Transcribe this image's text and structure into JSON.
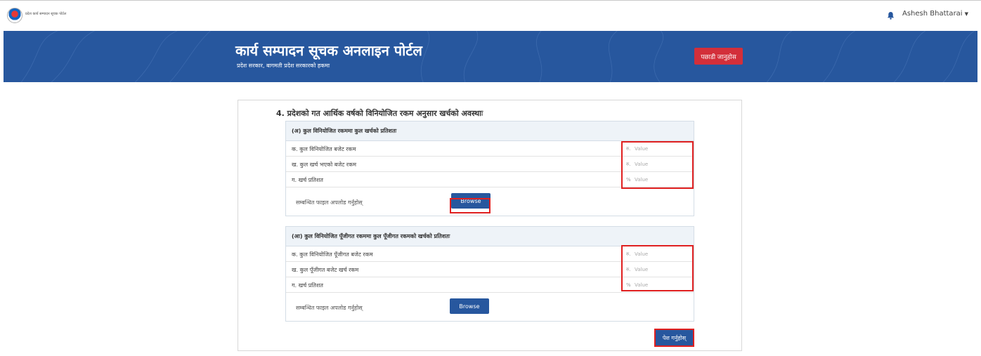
{
  "header": {
    "logo_text": "प्रदेश कार्य सम्पादन सूचक पोर्टल",
    "user_name": "Ashesh Bhattarai"
  },
  "banner": {
    "title": "कार्य सम्पादन सूचक अनलाइन पोर्टल",
    "subtitle": "प्रदेश सरकार, बागमती प्रदेश सरकारको हकमा",
    "logout_label": "पछाडी जानुहोस"
  },
  "form": {
    "section_title": "4. प्रदेशको गत आर्थिक वर्षको विनियोजित रकम अनुसार खर्चको अवस्थाः",
    "panel_a": {
      "heading": "(अ) कुल विनियोजित रकममा कुल खर्चको प्रतिशतः",
      "rows": [
        {
          "label": "क. कुल विनियोजित बजेट रकम",
          "unit": "रु.",
          "placeholder": "Value"
        },
        {
          "label": "ख. कुल खर्च भएको बजेट रकम",
          "unit": "रु.",
          "placeholder": "Value"
        },
        {
          "label": "ग. खर्च प्रतिशत",
          "unit": "%",
          "placeholder": "Value"
        }
      ],
      "upload_label": "सम्बन्धित फाइल अपलोड गर्नुहोस्",
      "browse_label": "Browse"
    },
    "panel_b": {
      "heading": "(आ) कुल विनियोजित पूँजीगत रकममा कुल पूँजीगत रकमको खर्चको प्रतिशतः",
      "rows": [
        {
          "label": "क. कुल विनियोजित पूँजीगत बजेट रकम",
          "unit": "रु.",
          "placeholder": "Value"
        },
        {
          "label": "ख. कुल पूँजीगत बजेट खर्च रकम",
          "unit": "रु.",
          "placeholder": "Value"
        },
        {
          "label": "ग. खर्च प्रतिशत",
          "unit": "%",
          "placeholder": "Value"
        }
      ],
      "upload_label": "सम्बन्धित फाइल अपलोड गर्नुहोस्",
      "browse_label": "Browse"
    },
    "submit_label": "पेश गर्नुहोस्"
  },
  "colors": {
    "brand_blue": "#27579e",
    "danger_red": "#d32f3a",
    "highlight_red": "#e02020"
  },
  "icons": {
    "logo": "nepal-emblem-icon",
    "notification": "bell-icon",
    "user_menu": "caret-down-icon"
  }
}
